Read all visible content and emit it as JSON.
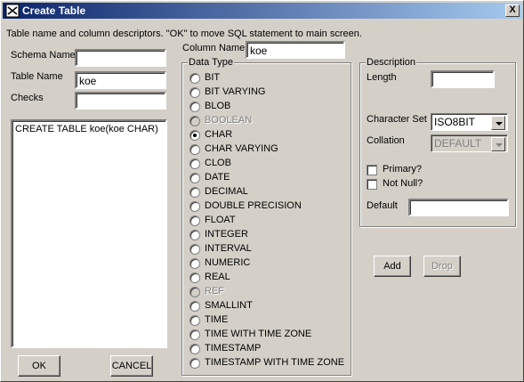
{
  "window": {
    "title": "Create Table",
    "close_glyph": "X"
  },
  "instructions": "Table name and column descriptors.  \"OK\" to move SQL statement to main screen.",
  "left": {
    "schema_label": "Schema Name",
    "schema_value": "",
    "table_label": "Table Name",
    "table_value": "koe",
    "checks_label": "Checks",
    "checks_value": "",
    "sql_text": "CREATE TABLE koe(koe CHAR)",
    "ok_label": "OK",
    "cancel_label": "CANCEL"
  },
  "column": {
    "label": "Column Name",
    "value": "koe"
  },
  "data_type": {
    "legend": "Data Type",
    "selected": "CHAR",
    "options": [
      {
        "label": "BIT",
        "enabled": true
      },
      {
        "label": "BIT VARYING",
        "enabled": true
      },
      {
        "label": "BLOB",
        "enabled": true
      },
      {
        "label": "BOOLEAN",
        "enabled": false
      },
      {
        "label": "CHAR",
        "enabled": true
      },
      {
        "label": "CHAR VARYING",
        "enabled": true
      },
      {
        "label": "CLOB",
        "enabled": true
      },
      {
        "label": "DATE",
        "enabled": true
      },
      {
        "label": "DECIMAL",
        "enabled": true
      },
      {
        "label": "DOUBLE PRECISION",
        "enabled": true
      },
      {
        "label": "FLOAT",
        "enabled": true
      },
      {
        "label": "INTEGER",
        "enabled": true
      },
      {
        "label": "INTERVAL",
        "enabled": true
      },
      {
        "label": "NUMERIC",
        "enabled": true
      },
      {
        "label": "REAL",
        "enabled": true
      },
      {
        "label": "REF",
        "enabled": false
      },
      {
        "label": "SMALLINT",
        "enabled": true
      },
      {
        "label": "TIME",
        "enabled": true
      },
      {
        "label": "TIME WITH TIME ZONE",
        "enabled": true
      },
      {
        "label": "TIMESTAMP",
        "enabled": true
      },
      {
        "label": "TIMESTAMP WITH TIME ZONE",
        "enabled": true
      }
    ]
  },
  "description": {
    "legend": "Description",
    "length_label": "Length",
    "length_value": "",
    "charset_label": "Character Set",
    "charset_value": "ISO8BIT",
    "collation_label": "Collation",
    "collation_value": "DEFAULT",
    "primary_label": "Primary?",
    "notnull_label": "Not Null?",
    "default_label": "Default",
    "default_value": ""
  },
  "buttons": {
    "add_label": "Add",
    "drop_label": "Drop"
  }
}
